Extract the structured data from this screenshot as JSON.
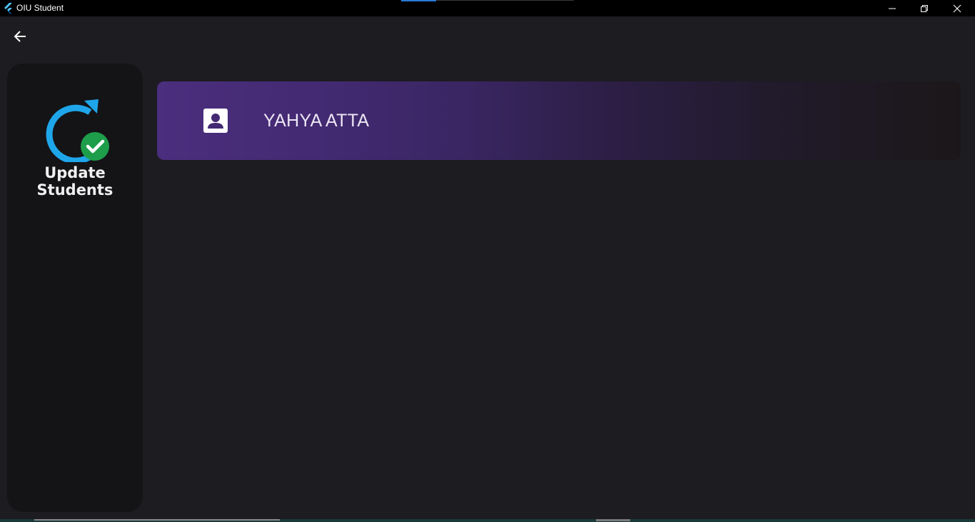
{
  "window": {
    "title": "OIU Student",
    "logo_icon": "flutter-logo-icon",
    "controls": [
      "minimize-icon",
      "restore-icon",
      "close-icon"
    ]
  },
  "nav": {
    "back_icon": "arrow-left-icon"
  },
  "sidebar": {
    "icon": "refresh-check-icon",
    "label": "Update Students"
  },
  "students": [
    {
      "name": "YAHYA ATTA",
      "icon": "contact-card-icon"
    }
  ],
  "colors": {
    "background": "#1d1c21",
    "sidebar": "#141417",
    "card_gradient_start": "#4b2e7e",
    "card_gradient_end": "#1b1719",
    "refresh_blue": "#1fa6ea",
    "check_green": "#1e9e4a"
  }
}
